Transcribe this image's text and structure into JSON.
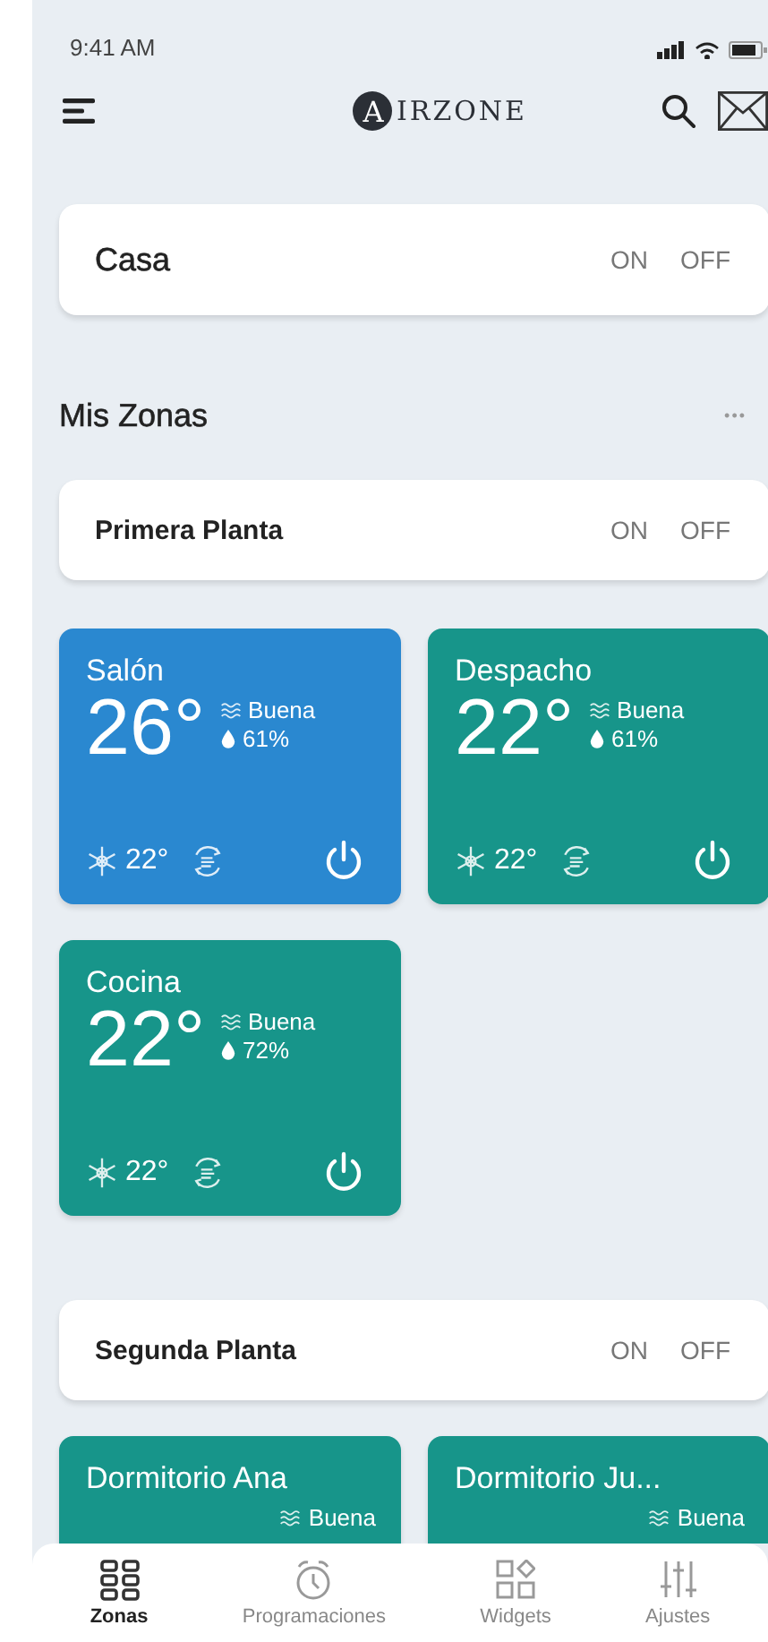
{
  "status_bar": {
    "time": "9:41 AM"
  },
  "header": {
    "logo_letter": "A",
    "logo_text": "IRZONE"
  },
  "home": {
    "name": "Casa",
    "on_label": "ON",
    "off_label": "OFF"
  },
  "section": {
    "title": "Mis Zonas",
    "more": "•••"
  },
  "groups": [
    {
      "name": "Primera Planta",
      "on_label": "ON",
      "off_label": "OFF",
      "zones": [
        {
          "name": "Salón",
          "temp": "26°",
          "air": "Buena",
          "humidity": "61%",
          "setpoint": "22°",
          "color": "#2a88d0"
        },
        {
          "name": "Despacho",
          "temp": "22°",
          "air": "Buena",
          "humidity": "61%",
          "setpoint": "22°",
          "color": "#17958a"
        },
        {
          "name": "Cocina",
          "temp": "22°",
          "air": "Buena",
          "humidity": "72%",
          "setpoint": "22°",
          "color": "#17958a"
        }
      ]
    },
    {
      "name": "Segunda Planta",
      "on_label": "ON",
      "off_label": "OFF",
      "zones": [
        {
          "name": "Dormitorio Ana",
          "air": "Buena",
          "color": "#17958a"
        },
        {
          "name": "Dormitorio Ju...",
          "air": "Buena",
          "color": "#17958a"
        }
      ]
    }
  ],
  "tabs": [
    {
      "label": "Zonas",
      "selected": true
    },
    {
      "label": "Programaciones",
      "selected": false
    },
    {
      "label": "Widgets",
      "selected": false
    },
    {
      "label": "Ajustes",
      "selected": false
    }
  ]
}
